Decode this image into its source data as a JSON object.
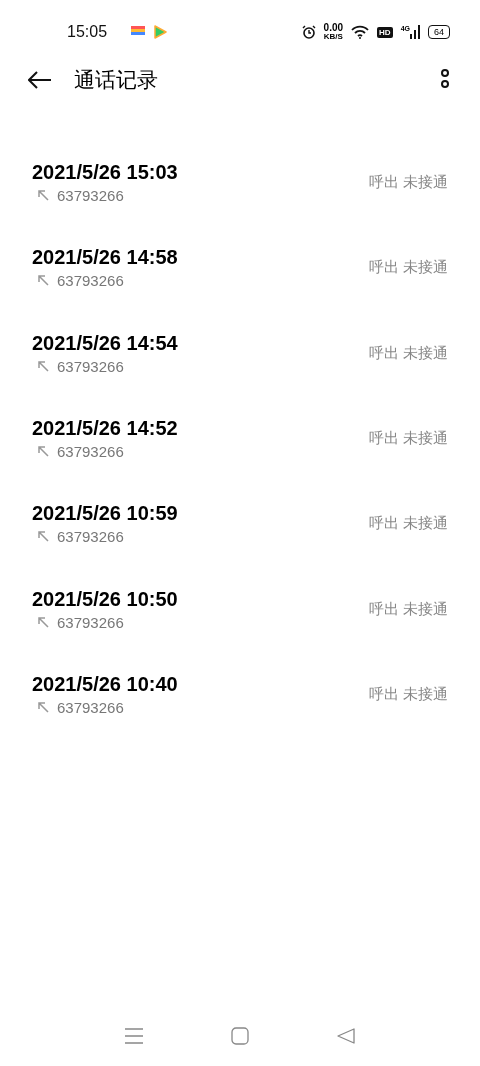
{
  "status_bar": {
    "time": "15:05",
    "speed_value": "0.00",
    "speed_unit": "KB/S",
    "hd": "HD",
    "network": "4G",
    "battery": "64"
  },
  "header": {
    "title": "通话记录"
  },
  "calls": [
    {
      "time": "2021/5/26 15:03",
      "number": "63793266",
      "status": "呼出 未接通"
    },
    {
      "time": "2021/5/26 14:58",
      "number": "63793266",
      "status": "呼出 未接通"
    },
    {
      "time": "2021/5/26 14:54",
      "number": "63793266",
      "status": "呼出 未接通"
    },
    {
      "time": "2021/5/26 14:52",
      "number": "63793266",
      "status": "呼出 未接通"
    },
    {
      "time": "2021/5/26 10:59",
      "number": "63793266",
      "status": "呼出 未接通"
    },
    {
      "time": "2021/5/26 10:50",
      "number": "63793266",
      "status": "呼出 未接通"
    },
    {
      "time": "2021/5/26 10:40",
      "number": "63793266",
      "status": "呼出 未接通"
    }
  ]
}
